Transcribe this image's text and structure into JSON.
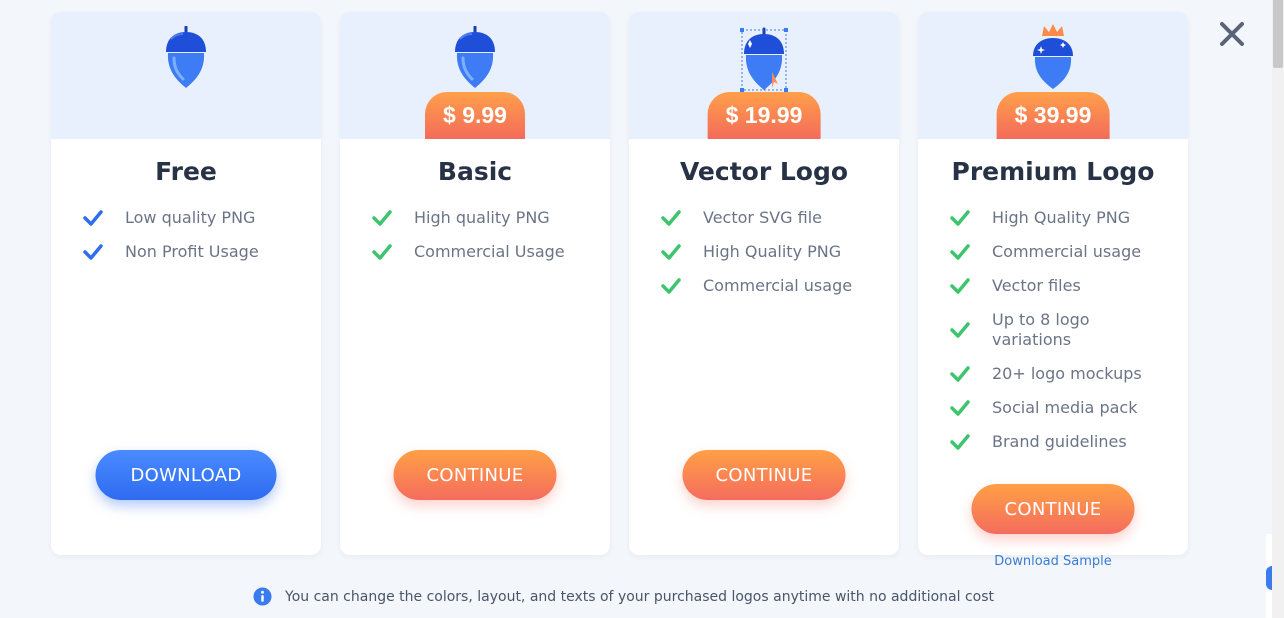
{
  "close_icon": "close-icon",
  "colors": {
    "accent_blue": "#3a7bf0",
    "accent_orange": "#ff9a48",
    "check_green": "#3ec46d",
    "check_blue": "#2f6ef0",
    "card_header": "#e9f0fd"
  },
  "plans": [
    {
      "name": "Free",
      "price": "",
      "icon": "acorn-icon",
      "check_color": "blue",
      "features": [
        "Low quality PNG",
        "Non Profit Usage"
      ],
      "button": "DOWNLOAD"
    },
    {
      "name": "Basic",
      "price": "$ 9.99",
      "icon": "acorn-icon",
      "check_color": "green",
      "features": [
        "High quality PNG",
        "Commercial Usage"
      ],
      "button": "CONTINUE"
    },
    {
      "name": "Vector Logo",
      "price": "$ 19.99",
      "icon": "vector-acorn-icon",
      "check_color": "green",
      "features": [
        "Vector SVG file",
        "High Quality PNG",
        "Commercial usage"
      ],
      "button": "CONTINUE"
    },
    {
      "name": "Premium Logo",
      "price": "$ 39.99",
      "icon": "crowned-acorn-icon",
      "check_color": "green",
      "features": [
        "High Quality PNG",
        "Commercial usage",
        "Vector files",
        "Up to 8 logo variations",
        "20+ logo mockups",
        "Social media pack",
        "Brand guidelines"
      ],
      "button": "CONTINUE",
      "sample_link": "Download Sample"
    }
  ],
  "footer": {
    "icon": "info-icon",
    "text": "You can change the colors, layout, and texts of your purchased logos anytime with no additional cost"
  }
}
